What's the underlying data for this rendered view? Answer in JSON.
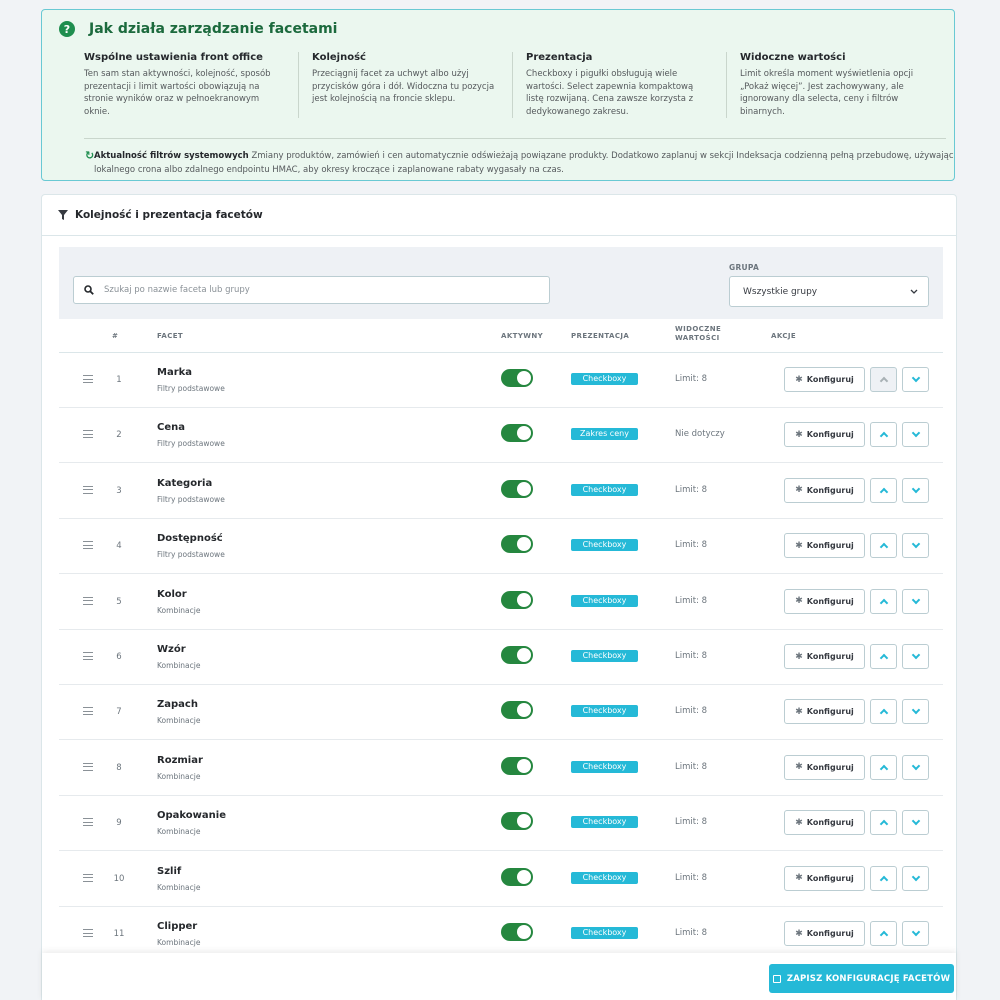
{
  "info": {
    "title": "Jak działa zarządzanie facetami",
    "columns": [
      {
        "heading": "Wspólne ustawienia front office",
        "text": "Ten sam stan aktywności, kolejność, sposób prezentacji i limit wartości obowiązują na stronie wyników oraz w pełnoekranowym oknie."
      },
      {
        "heading": "Kolejność",
        "text": "Przeciągnij facet za uchwyt albo użyj przycisków góra i dół. Widoczna tu pozycja jest kolejnością na froncie sklepu."
      },
      {
        "heading": "Prezentacja",
        "text": "Checkboxy i pigułki obsługują wiele wartości. Select zapewnia kompaktową listę rozwijaną. Cena zawsze korzysta z dedykowanego zakresu."
      },
      {
        "heading": "Widoczne wartości",
        "text": "Limit określa moment wyświetlenia opcji „Pokaż więcej”. Jest zachowywany, ale ignorowany dla selecta, ceny i filtrów binarnych."
      }
    ],
    "note_title": "Aktualność filtrów systemowych",
    "note_text": "Zmiany produktów, zamówień i cen automatycznie odświeżają powiązane produkty. Dodatkowo zaplanuj w sekcji Indeksacja codzienną pełną przebudowę, używając lokalnego crona albo zdalnego endpointu HMAC, aby okresy kroczące i zaplanowane rabaty wygasały na czas."
  },
  "card": {
    "title": "Kolejność i prezentacja facetów"
  },
  "filters": {
    "search_placeholder": "Szukaj po nazwie faceta lub grupy",
    "group_label": "GRUPA",
    "group_selected": "Wszystkie grupy"
  },
  "table": {
    "headers": {
      "num": "#",
      "facet": "FACET",
      "active": "AKTYWNY",
      "presentation": "PREZENTACJA",
      "visible": "WIDOCZNE WARTOŚCI",
      "actions": "AKCJE"
    },
    "configure_label": "Konfiguruj",
    "rows": [
      {
        "num": "1",
        "name": "Marka",
        "group": "Filtry podstawowe",
        "active": true,
        "presentation": "Checkboxy",
        "visible": "Limit: 8",
        "up_disabled": true
      },
      {
        "num": "2",
        "name": "Cena",
        "group": "Filtry podstawowe",
        "active": true,
        "presentation": "Zakres ceny",
        "visible": "Nie dotyczy",
        "up_disabled": false
      },
      {
        "num": "3",
        "name": "Kategoria",
        "group": "Filtry podstawowe",
        "active": true,
        "presentation": "Checkboxy",
        "visible": "Limit: 8",
        "up_disabled": false
      },
      {
        "num": "4",
        "name": "Dostępność",
        "group": "Filtry podstawowe",
        "active": true,
        "presentation": "Checkboxy",
        "visible": "Limit: 8",
        "up_disabled": false
      },
      {
        "num": "5",
        "name": "Kolor",
        "group": "Kombinacje",
        "active": true,
        "presentation": "Checkboxy",
        "visible": "Limit: 8",
        "up_disabled": false
      },
      {
        "num": "6",
        "name": "Wzór",
        "group": "Kombinacje",
        "active": true,
        "presentation": "Checkboxy",
        "visible": "Limit: 8",
        "up_disabled": false
      },
      {
        "num": "7",
        "name": "Zapach",
        "group": "Kombinacje",
        "active": true,
        "presentation": "Checkboxy",
        "visible": "Limit: 8",
        "up_disabled": false
      },
      {
        "num": "8",
        "name": "Rozmiar",
        "group": "Kombinacje",
        "active": true,
        "presentation": "Checkboxy",
        "visible": "Limit: 8",
        "up_disabled": false
      },
      {
        "num": "9",
        "name": "Opakowanie",
        "group": "Kombinacje",
        "active": true,
        "presentation": "Checkboxy",
        "visible": "Limit: 8",
        "up_disabled": false
      },
      {
        "num": "10",
        "name": "Szlif",
        "group": "Kombinacje",
        "active": true,
        "presentation": "Checkboxy",
        "visible": "Limit: 8",
        "up_disabled": false
      },
      {
        "num": "11",
        "name": "Clipper",
        "group": "Kombinacje",
        "active": true,
        "presentation": "Checkboxy",
        "visible": "Limit: 8",
        "up_disabled": false
      }
    ]
  },
  "footer": {
    "save_label": "ZAPISZ KONFIGURACJĘ FACETÓW"
  },
  "colors": {
    "accent": "#25b9d7",
    "toggle_on": "#25873f",
    "info_bg": "#ebf7ef",
    "info_title": "#1c6a3d"
  }
}
